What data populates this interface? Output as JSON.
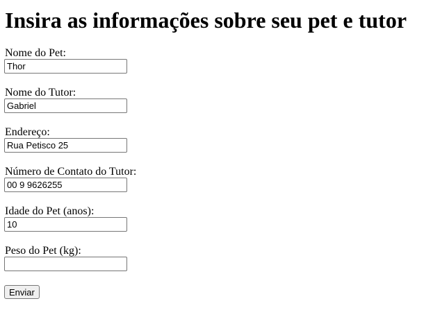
{
  "title": "Insira as informações sobre seu pet e tutor",
  "fields": [
    {
      "label": "Nome do Pet:",
      "value": "Thor"
    },
    {
      "label": "Nome do Tutor:",
      "value": "Gabriel"
    },
    {
      "label": "Endereço:",
      "value": "Rua Petisco 25"
    },
    {
      "label": "Número de Contato do Tutor:",
      "value": "00 9 9626255"
    },
    {
      "label": "Idade do Pet (anos):",
      "value": "10"
    },
    {
      "label": "Peso do Pet (kg):",
      "value": ""
    }
  ],
  "submit_label": "Enviar"
}
